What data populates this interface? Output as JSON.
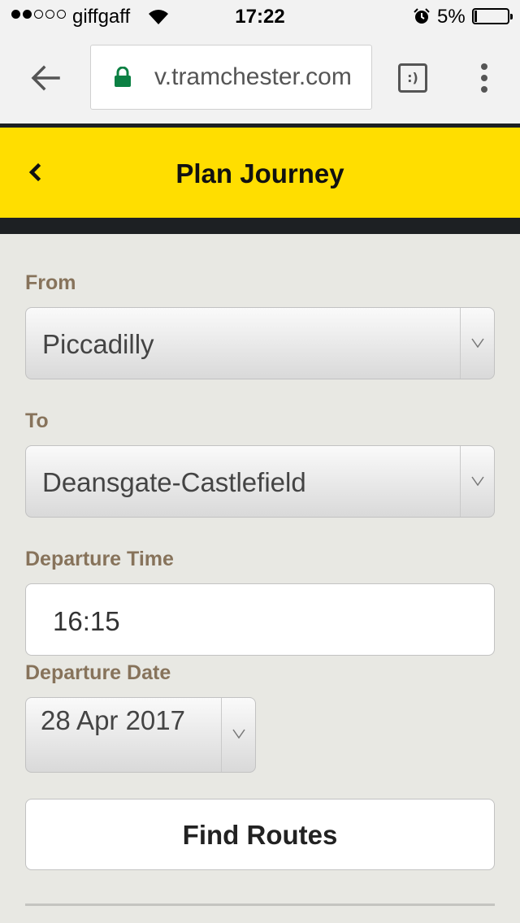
{
  "status_bar": {
    "signal_bars_filled": 2,
    "signal_bars_total": 5,
    "carrier": "giffgaff",
    "time": "17:22",
    "battery_percent": "5%",
    "battery_level": 0.05
  },
  "browser": {
    "url_visible": "v.tramchester.com",
    "tabs_icon_label": ":)",
    "icons": [
      "back-arrow-icon",
      "lock-icon",
      "tabs-icon",
      "more-menu-icon"
    ]
  },
  "header": {
    "title": "Plan Journey",
    "background": "#ffde00",
    "bar_color": "#1d2023"
  },
  "form": {
    "from_label": "From",
    "from_value": "Piccadilly",
    "to_label": "To",
    "to_value": "Deansgate-Castlefield",
    "time_label": "Departure Time",
    "time_value": "16:15",
    "date_label": "Departure Date",
    "date_value": "28 Apr 2017",
    "submit_label": "Find Routes",
    "label_color": "#87735b"
  }
}
